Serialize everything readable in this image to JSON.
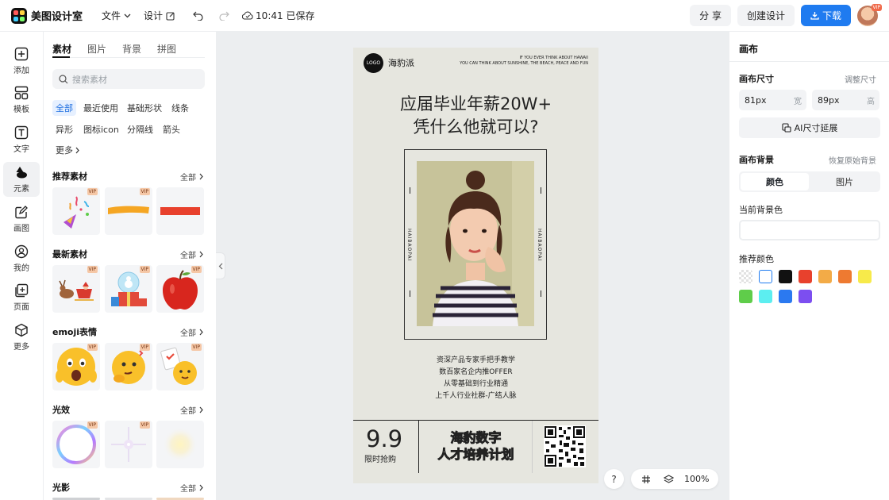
{
  "app": {
    "name": "美图设计室"
  },
  "menu": {
    "file": "文件",
    "design": "设计",
    "saved": "10:41 已保存"
  },
  "topright": {
    "share": "分 享",
    "create": "创建设计",
    "download": "下载",
    "avatar_vip": "VIP"
  },
  "rail": [
    {
      "label": "添加",
      "icon": "plus-square-icon"
    },
    {
      "label": "模板",
      "icon": "template-icon"
    },
    {
      "label": "文字",
      "icon": "text-icon"
    },
    {
      "label": "元素",
      "icon": "shapes-icon",
      "active": true
    },
    {
      "label": "画图",
      "icon": "draw-icon"
    },
    {
      "label": "我的",
      "icon": "user-icon"
    },
    {
      "label": "页面",
      "icon": "page-add-icon"
    },
    {
      "label": "更多",
      "icon": "cube-icon"
    }
  ],
  "panel": {
    "tabs": [
      "素材",
      "图片",
      "背景",
      "拼图"
    ],
    "search_placeholder": "搜索素材",
    "chips": [
      "全部",
      "最近使用",
      "基础形状",
      "线条",
      "异形",
      "图标icon",
      "分隔线",
      "箭头",
      "更多"
    ],
    "all_label": "全部",
    "vip_label": "VIP",
    "sections": [
      "推荐素材",
      "最新素材",
      "emoji表情",
      "光效",
      "光影"
    ]
  },
  "poster": {
    "logo": "LOGO",
    "brand": "海豹派",
    "tagline_1": "IF YOU EVER THINK ABOUT HAWAII",
    "tagline_2": "YOU CAN THINK ABOUT SUNSHINE, THE BEACH, PEACE AND FUN",
    "title_1": "应届毕业年薪20W+",
    "title_2": "凭什么他就可以?",
    "side_text": "HAIBAOPAI",
    "line_1": "资深产品专家手把手教学",
    "line_2": "数百家名企内推OFFER",
    "line_3": "从零基础到行业精通",
    "line_4": "上千人行业社群-广结人脉",
    "big_number": "9.9",
    "small_text": "限时抢购",
    "mid_1": "海豹数字",
    "mid_2": "人才培养计划"
  },
  "zoom": {
    "help": "?",
    "value": "100%"
  },
  "right": {
    "title": "画布",
    "size_label": "画布尺寸",
    "size_link": "调整尺寸",
    "width_value": "81px",
    "width_unit": "宽",
    "height_value": "89px",
    "height_unit": "高",
    "ai_button": "AI尺寸延展",
    "bg_label": "画布背景",
    "bg_link": "恢复原始背景",
    "seg_color": "颜色",
    "seg_image": "图片",
    "current_label": "当前背景色",
    "recommend_label": "推荐颜色",
    "swatches": [
      "transparent",
      "#ffffff",
      "#111111",
      "#e8412d",
      "#f3ab47",
      "#ee7a31",
      "#f7ea4a",
      "#5fcd4a",
      "#5ceef0",
      "#2b79f0",
      "#7c4ef0"
    ]
  }
}
